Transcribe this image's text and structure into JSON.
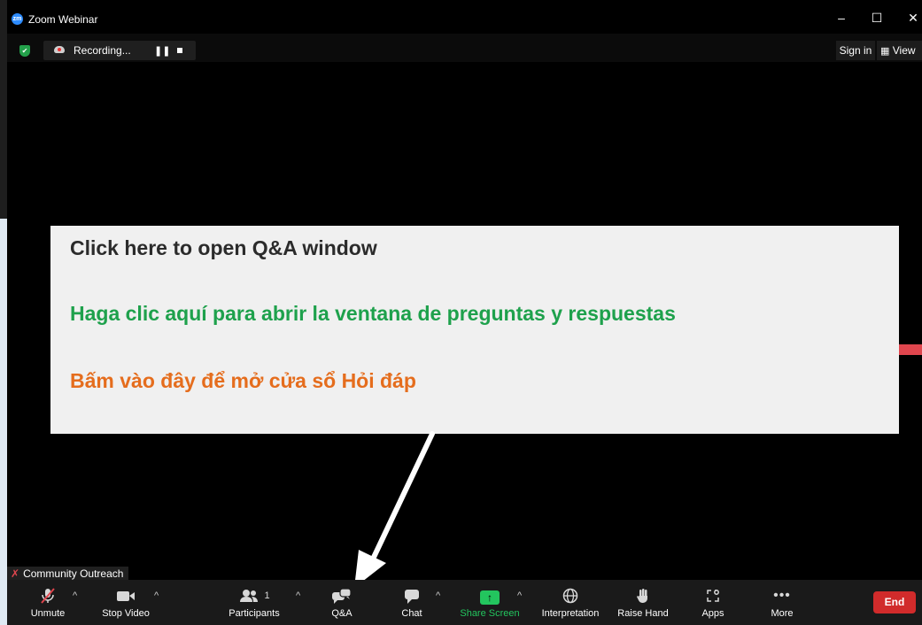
{
  "window": {
    "app_title": "Zoom Webinar",
    "controls": {
      "minimize": "–",
      "maximize": "☐",
      "close": "✕"
    },
    "accent": "#2d8cff"
  },
  "topbar": {
    "recording_label": "Recording...",
    "pause_glyph": "❚❚",
    "sign_in_label": "Sign in",
    "view_label": "View",
    "view_icon": "grid-icon"
  },
  "annotation": {
    "en": "Click here to open Q&A window",
    "es": "Haga clic aquí para abrir la ventana de preguntas y respuestas",
    "vi": "Bấm vào đây để mở cửa sổ Hỏi đáp",
    "colors": {
      "en": "#2b2b2b",
      "es": "#1ea14c",
      "vi": "#e56d1d"
    }
  },
  "participant": {
    "name": "Community Outreach",
    "muted": true
  },
  "toolbar": {
    "unmute_label": "Unmute",
    "stop_video_label": "Stop Video",
    "participants_label": "Participants",
    "participants_count": "1",
    "qa_label": "Q&A",
    "chat_label": "Chat",
    "share_screen_label": "Share Screen",
    "interpretation_label": "Interpretation",
    "raise_hand_label": "Raise Hand",
    "apps_label": "Apps",
    "more_label": "More",
    "end_label": "End",
    "caret_glyph": "^",
    "share_color": "#23c55e",
    "end_color": "#d12b2b"
  }
}
